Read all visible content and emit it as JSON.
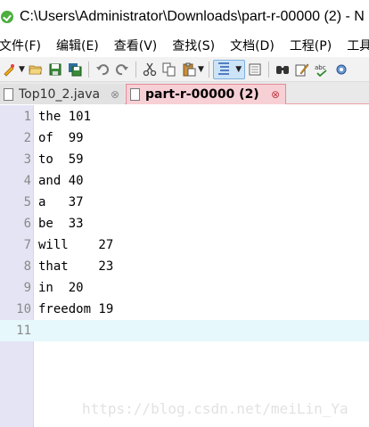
{
  "window": {
    "title": "C:\\Users\\Administrator\\Downloads\\part-r-00000 (2) - N",
    "accent_color": "#4caf3f"
  },
  "menu": [
    "文件(F)",
    "编辑(E)",
    "查看(V)",
    "查找(S)",
    "文档(D)",
    "工程(P)",
    "工具"
  ],
  "toolbar": {
    "icons": [
      "new-file-icon",
      "open-folder-icon",
      "save-icon",
      "save-all-icon",
      "undo-icon",
      "redo-icon",
      "cut-icon",
      "copy-icon",
      "paste-icon",
      "word-wrap-icon",
      "view-icon",
      "find-icon",
      "edit-icon",
      "spellcheck-icon",
      "settings-icon"
    ]
  },
  "tabs": [
    {
      "label": "Top10_2.java",
      "close": "⊗",
      "active": false
    },
    {
      "label": "part-r-00000 (2)",
      "close": "⊗",
      "active": true
    }
  ],
  "editor": {
    "lines": [
      {
        "num": "1",
        "text": "the 101"
      },
      {
        "num": "2",
        "text": "of  99"
      },
      {
        "num": "3",
        "text": "to  59"
      },
      {
        "num": "4",
        "text": "and 40"
      },
      {
        "num": "5",
        "text": "a   37"
      },
      {
        "num": "6",
        "text": "be  33"
      },
      {
        "num": "7",
        "text": "will    27"
      },
      {
        "num": "8",
        "text": "that    23"
      },
      {
        "num": "9",
        "text": "in  20"
      },
      {
        "num": "10",
        "text": "freedom 19"
      },
      {
        "num": "11",
        "text": ""
      }
    ],
    "current_line": 11
  },
  "watermark": "https://blog.csdn.net/meiLin_Ya"
}
